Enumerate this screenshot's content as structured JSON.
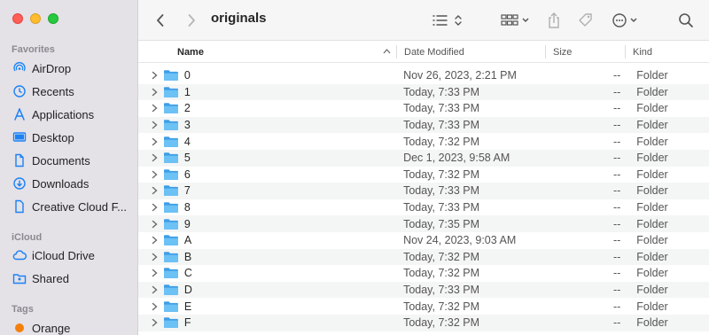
{
  "window": {
    "title": "originals"
  },
  "sidebar": {
    "sections": [
      {
        "title": "Favorites",
        "items": [
          {
            "label": "AirDrop",
            "icon": "airdrop-icon"
          },
          {
            "label": "Recents",
            "icon": "clock-icon"
          },
          {
            "label": "Applications",
            "icon": "applications-icon"
          },
          {
            "label": "Desktop",
            "icon": "desktop-icon"
          },
          {
            "label": "Documents",
            "icon": "document-icon"
          },
          {
            "label": "Downloads",
            "icon": "download-icon"
          },
          {
            "label": "Creative Cloud Files",
            "display": "Creative Cloud F...",
            "icon": "file-icon"
          }
        ]
      },
      {
        "title": "iCloud",
        "items": [
          {
            "label": "iCloud Drive",
            "icon": "cloud-icon"
          },
          {
            "label": "Shared",
            "icon": "shared-folder-icon"
          }
        ]
      },
      {
        "title": "Tags",
        "items": [
          {
            "label": "Orange",
            "icon": "tag-dot-icon",
            "color": "#f4800b"
          }
        ]
      }
    ]
  },
  "columns": {
    "name": "Name",
    "date": "Date Modified",
    "size": "Size",
    "kind": "Kind"
  },
  "files": [
    {
      "name": "0",
      "date": "Nov 26, 2023, 2:21 PM",
      "size": "--",
      "kind": "Folder"
    },
    {
      "name": "1",
      "date": "Today, 7:33 PM",
      "size": "--",
      "kind": "Folder"
    },
    {
      "name": "2",
      "date": "Today, 7:33 PM",
      "size": "--",
      "kind": "Folder"
    },
    {
      "name": "3",
      "date": "Today, 7:33 PM",
      "size": "--",
      "kind": "Folder"
    },
    {
      "name": "4",
      "date": "Today, 7:32 PM",
      "size": "--",
      "kind": "Folder"
    },
    {
      "name": "5",
      "date": "Dec 1, 2023, 9:58 AM",
      "size": "--",
      "kind": "Folder"
    },
    {
      "name": "6",
      "date": "Today, 7:32 PM",
      "size": "--",
      "kind": "Folder"
    },
    {
      "name": "7",
      "date": "Today, 7:33 PM",
      "size": "--",
      "kind": "Folder"
    },
    {
      "name": "8",
      "date": "Today, 7:33 PM",
      "size": "--",
      "kind": "Folder"
    },
    {
      "name": "9",
      "date": "Today, 7:35 PM",
      "size": "--",
      "kind": "Folder"
    },
    {
      "name": "A",
      "date": "Nov 24, 2023, 9:03 AM",
      "size": "--",
      "kind": "Folder"
    },
    {
      "name": "B",
      "date": "Today, 7:32 PM",
      "size": "--",
      "kind": "Folder"
    },
    {
      "name": "C",
      "date": "Today, 7:32 PM",
      "size": "--",
      "kind": "Folder"
    },
    {
      "name": "D",
      "date": "Today, 7:33 PM",
      "size": "--",
      "kind": "Folder"
    },
    {
      "name": "E",
      "date": "Today, 7:32 PM",
      "size": "--",
      "kind": "Folder"
    },
    {
      "name": "F",
      "date": "Today, 7:32 PM",
      "size": "--",
      "kind": "Folder"
    }
  ],
  "colors": {
    "accent": "#1a82f5",
    "folder": "#5bb6f0",
    "sidebar_bg": "#e4e1e7"
  }
}
